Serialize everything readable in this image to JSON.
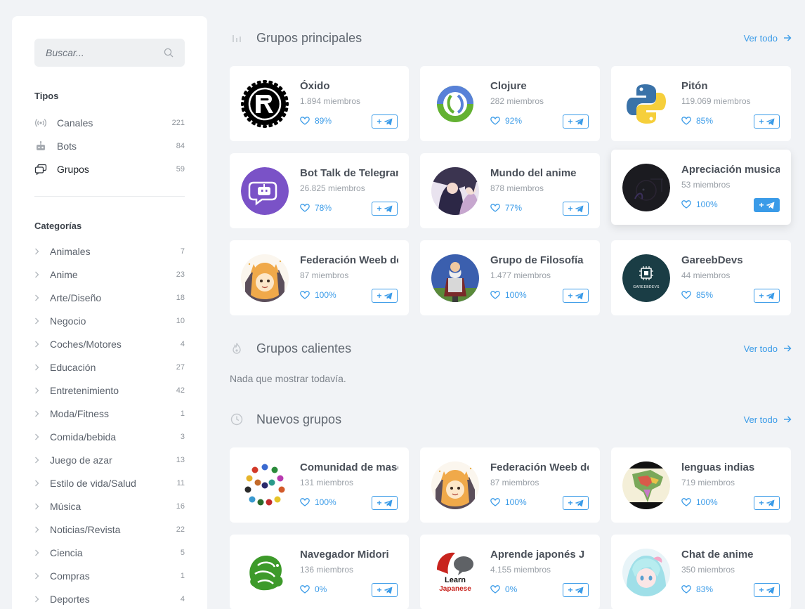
{
  "search": {
    "placeholder": "Buscar..."
  },
  "types": {
    "title": "Tipos",
    "items": [
      {
        "label": "Canales",
        "count": "221",
        "icon": "broadcast-icon"
      },
      {
        "label": "Bots",
        "count": "84",
        "icon": "robot-icon"
      },
      {
        "label": "Grupos",
        "count": "59",
        "icon": "chat-icon"
      }
    ]
  },
  "categories": {
    "title": "Categorías",
    "items": [
      {
        "label": "Animales",
        "count": "7"
      },
      {
        "label": "Anime",
        "count": "23"
      },
      {
        "label": "Arte/Diseño",
        "count": "18"
      },
      {
        "label": "Negocio",
        "count": "10"
      },
      {
        "label": "Coches/Motores",
        "count": "4"
      },
      {
        "label": "Educación",
        "count": "27"
      },
      {
        "label": "Entretenimiento",
        "count": "42"
      },
      {
        "label": "Moda/Fitness",
        "count": "1"
      },
      {
        "label": "Comida/bebida",
        "count": "3"
      },
      {
        "label": "Juego de azar",
        "count": "13"
      },
      {
        "label": "Estilo de vida/Salud",
        "count": "11"
      },
      {
        "label": "Música",
        "count": "16"
      },
      {
        "label": "Noticias/Revista",
        "count": "22"
      },
      {
        "label": "Ciencia",
        "count": "5"
      },
      {
        "label": "Compras",
        "count": "1"
      },
      {
        "label": "Deportes",
        "count": "4"
      }
    ]
  },
  "sections": {
    "top": {
      "title": "Grupos principales",
      "more": "Ver todo"
    },
    "hot": {
      "title": "Grupos calientes",
      "more": "Ver todo",
      "empty": "Nada que mostrar todavía."
    },
    "new": {
      "title": "Nuevos grupos",
      "more": "Ver todo"
    }
  },
  "top_groups": [
    {
      "name": "Óxido",
      "members": "1.894 miembros",
      "rating": "89%"
    },
    {
      "name": "Clojure",
      "members": "282 miembros",
      "rating": "92%"
    },
    {
      "name": "Pitón",
      "members": "119.069 miembros",
      "rating": "85%"
    },
    {
      "name": "Bot Talk de Telegram",
      "members": "26.825 miembros",
      "rating": "78%"
    },
    {
      "name": "Mundo del anime",
      "members": "878 miembros",
      "rating": "77%"
    },
    {
      "name": "Apreciación musical",
      "members": "53 miembros",
      "rating": "100%"
    },
    {
      "name": "Federación Weeb de",
      "members": "87 miembros",
      "rating": "100%"
    },
    {
      "name": "Grupo de Filosofía",
      "members": "1.477 miembros",
      "rating": "100%"
    },
    {
      "name": "GareebDevs",
      "members": "44 miembros",
      "rating": "85%"
    }
  ],
  "new_groups": [
    {
      "name": "Comunidad de mascotas",
      "members": "131 miembros",
      "rating": "100%"
    },
    {
      "name": "Federación Weeb de",
      "members": "87 miembros",
      "rating": "100%"
    },
    {
      "name": "lenguas indias",
      "members": "719 miembros",
      "rating": "100%"
    },
    {
      "name": "Navegador Midori",
      "members": "136 miembros",
      "rating": "0%"
    },
    {
      "name": "Aprende japonés J",
      "members": "4.155 miembros",
      "rating": "0%"
    },
    {
      "name": "Chat de anime",
      "members": "350 miembros",
      "rating": "83%"
    }
  ],
  "join_label": "+",
  "avatar_texts": {
    "gareeb": "GAREEBDEVS",
    "learn": "Learn",
    "japanese": "Japanese"
  },
  "colors": {
    "accent": "#3a9be8",
    "background": "#f1f3f6"
  }
}
